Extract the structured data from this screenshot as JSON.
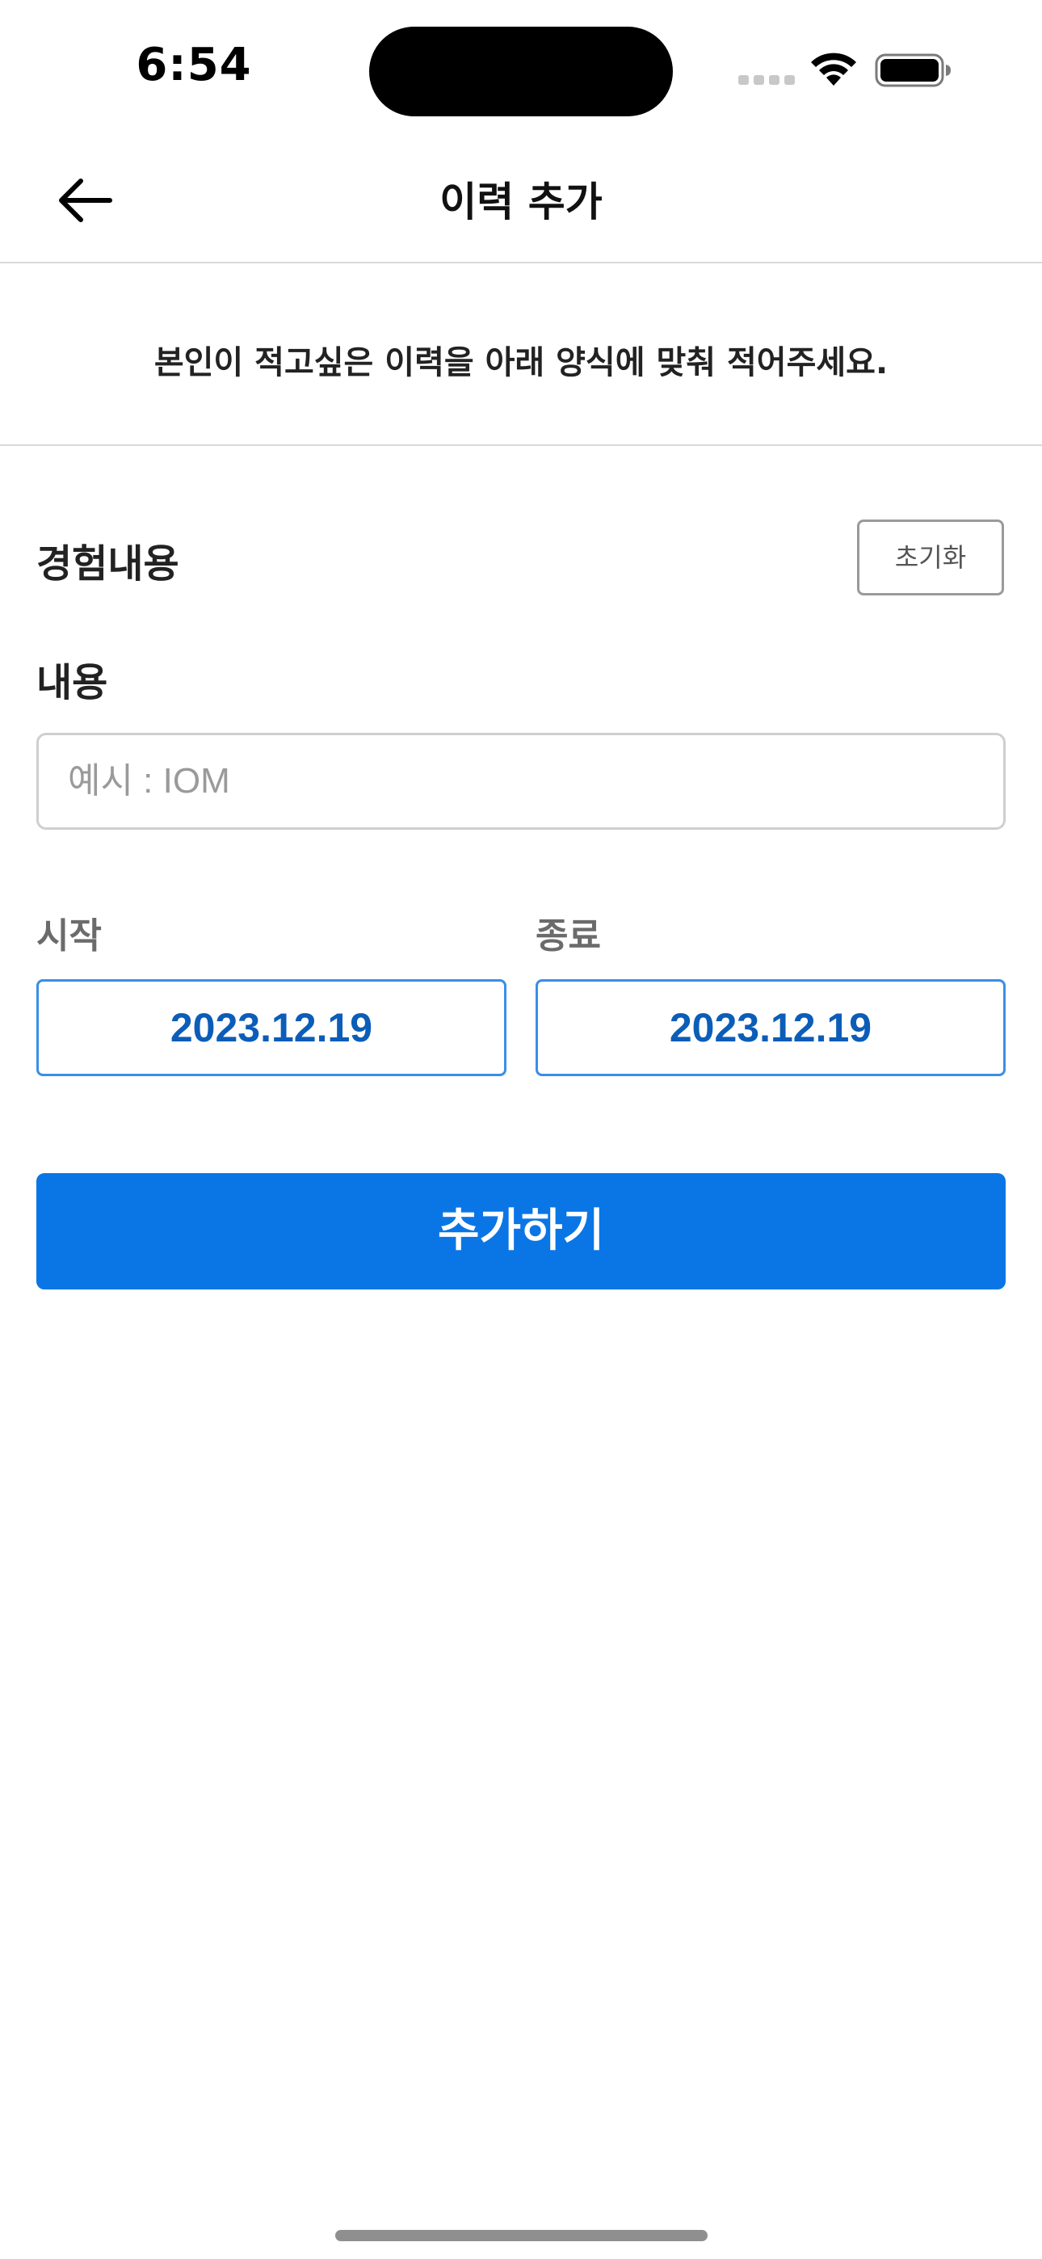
{
  "status_bar": {
    "time": "6:54"
  },
  "nav": {
    "title": "이력 추가",
    "back_icon": "arrow-left-icon"
  },
  "instruction": {
    "text": "본인이 적고싶은 이력을 아래 양식에 맞춰 적어주세요."
  },
  "form": {
    "section_title": "경험내용",
    "reset_label": "초기화",
    "content_label": "내용",
    "content_value": "",
    "content_placeholder": "예시 : IOM",
    "start_label": "시작",
    "start_value": "2023.12.19",
    "end_label": "종료",
    "end_value": "2023.12.19",
    "submit_label": "추가하기"
  },
  "colors": {
    "accent": "#0a76e6",
    "date_text": "#0b5db8",
    "date_border": "#3a8ee6",
    "divider": "#d9d9d9"
  }
}
